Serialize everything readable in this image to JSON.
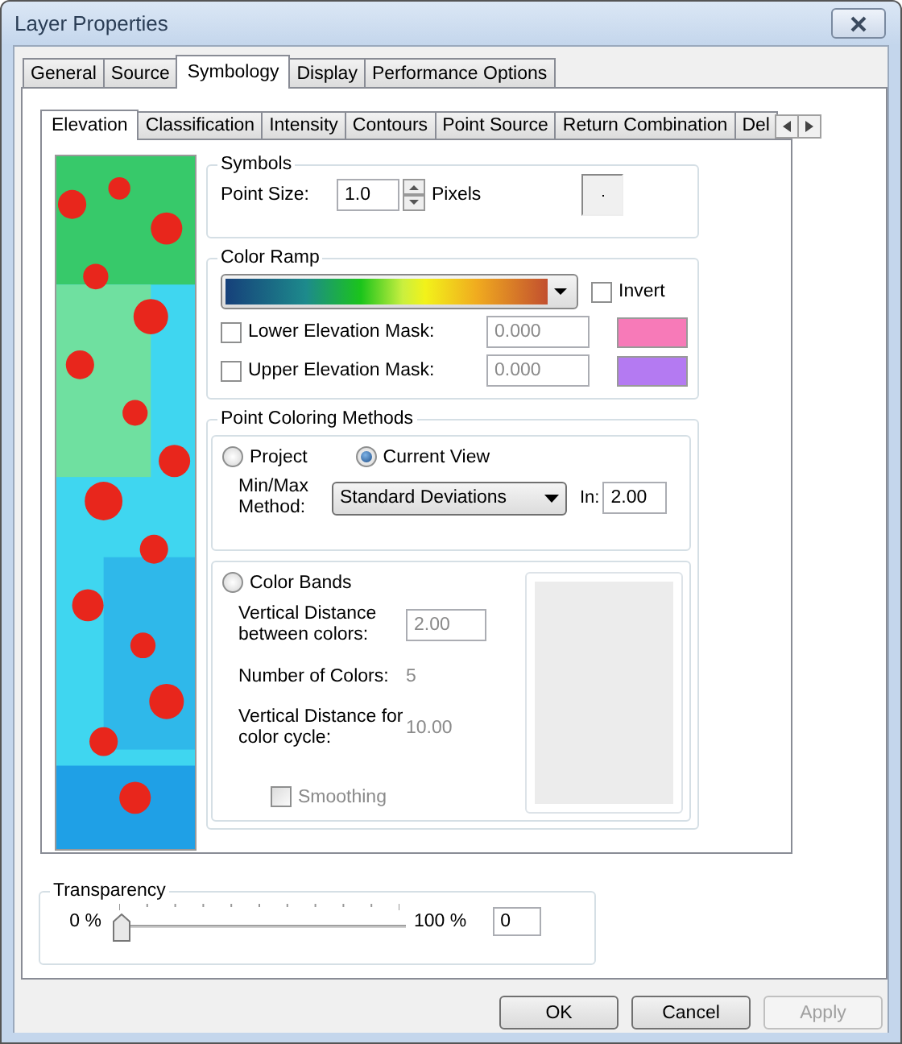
{
  "window": {
    "title": "Layer Properties"
  },
  "tabs": [
    {
      "label": "General",
      "selected": false
    },
    {
      "label": "Source",
      "selected": false
    },
    {
      "label": "Symbology",
      "selected": true
    },
    {
      "label": "Display",
      "selected": false
    },
    {
      "label": "Performance Options",
      "selected": false
    }
  ],
  "subtabs": [
    {
      "label": "Elevation",
      "selected": true
    },
    {
      "label": "Classification",
      "selected": false
    },
    {
      "label": "Intensity",
      "selected": false
    },
    {
      "label": "Contours",
      "selected": false
    },
    {
      "label": "Point Source",
      "selected": false
    },
    {
      "label": "Return Combination",
      "selected": false
    },
    {
      "label": "Del",
      "selected": false
    }
  ],
  "symbols": {
    "title": "Symbols",
    "point_size_label": "Point Size:",
    "point_size": "1.0",
    "unit": "Pixels"
  },
  "color_ramp": {
    "title": "Color Ramp",
    "invert": {
      "label": "Invert",
      "checked": false
    },
    "masks": [
      {
        "label": "Lower Elevation Mask:",
        "checked": false,
        "value": "0.000",
        "color": "#f77ab8"
      },
      {
        "label": "Upper Elevation Mask:",
        "checked": false,
        "value": "0.000",
        "color": "#b47af2"
      }
    ]
  },
  "point_coloring": {
    "title": "Point Coloring Methods",
    "options": [
      {
        "label": "Project",
        "selected": false
      },
      {
        "label": "Current View",
        "selected": true
      },
      {
        "label": "Color Bands",
        "selected": false
      }
    ],
    "method_label": "Min/Max Method:",
    "method": "Standard Deviations",
    "n_label": "In:",
    "n_value": "2.00",
    "bands": [
      {
        "label": "Vertical Distance between colors:",
        "value": "2.00",
        "kind": "field"
      },
      {
        "label": "Number of Colors:",
        "value": "5",
        "kind": "text"
      },
      {
        "label": "Vertical Distance for color cycle:",
        "value": "10.00",
        "kind": "text"
      }
    ],
    "smoothing": {
      "label": "Smoothing",
      "checked": false,
      "disabled": true
    }
  },
  "transparency": {
    "title": "Transparency",
    "min": "0 %",
    "max": "100 %",
    "level": 0,
    "value": "0"
  },
  "buttons": [
    {
      "label": "OK",
      "disabled": false
    },
    {
      "label": "Cancel",
      "disabled": false
    },
    {
      "label": "Apply",
      "disabled": true
    }
  ]
}
